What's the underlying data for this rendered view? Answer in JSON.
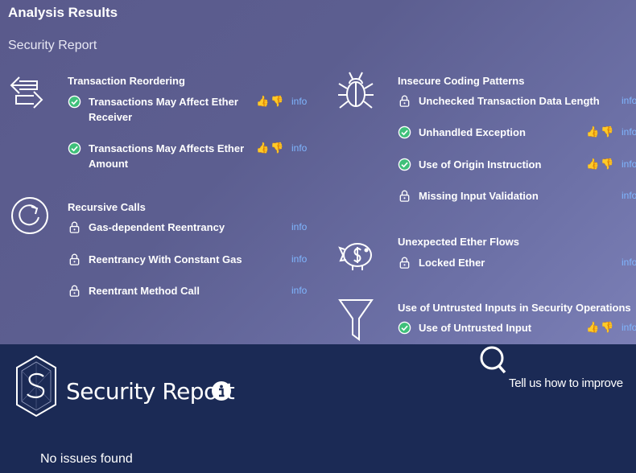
{
  "header": {
    "title": "Analysis Results",
    "subtitle": "Security Report"
  },
  "categories": {
    "reordering": {
      "title": "Transaction Reordering",
      "items": [
        {
          "label_line1": "Transactions May Affect Ether",
          "label_line2": "Receiver",
          "status": "passed",
          "info": "info"
        },
        {
          "label_line1": "Transactions May Affects Ether",
          "label_line2": "Amount",
          "status": "passed",
          "info": "info"
        }
      ]
    },
    "recursive": {
      "title": "Recursive Calls",
      "items": [
        {
          "label": "Gas-dependent Reentrancy",
          "status": "locked",
          "info": "info"
        },
        {
          "label": "Reentrancy With Constant Gas",
          "status": "locked",
          "info": "info"
        },
        {
          "label": "Reentrant Method Call",
          "status": "locked",
          "info": "info"
        }
      ]
    },
    "insecure": {
      "title": "Insecure Coding Patterns",
      "items": [
        {
          "label": "Unchecked Transaction Data Length",
          "status": "locked",
          "info": "info"
        },
        {
          "label": "Unhandled Exception",
          "status": "passed",
          "info": "info"
        },
        {
          "label": "Use of Origin Instruction",
          "status": "passed",
          "info": "info"
        },
        {
          "label": "Missing Input Validation",
          "status": "locked",
          "info": "info"
        }
      ]
    },
    "ether_flows": {
      "title": "Unexpected Ether Flows",
      "items": [
        {
          "label": "Locked Ether",
          "status": "locked",
          "info": "info"
        }
      ]
    },
    "untrusted": {
      "title": "Use of Untrusted Inputs in Security Operations",
      "items": [
        {
          "label": "Use of Untrusted Input",
          "status": "passed",
          "info": "info"
        }
      ]
    }
  },
  "footer": {
    "report_title": "Security Report",
    "feedback": "Tell us how to improve",
    "no_issues": "No issues found"
  },
  "colors": {
    "passed": "#3fc07a",
    "info_link": "#7fb6ff",
    "footer_bg": "#1b2a55"
  }
}
